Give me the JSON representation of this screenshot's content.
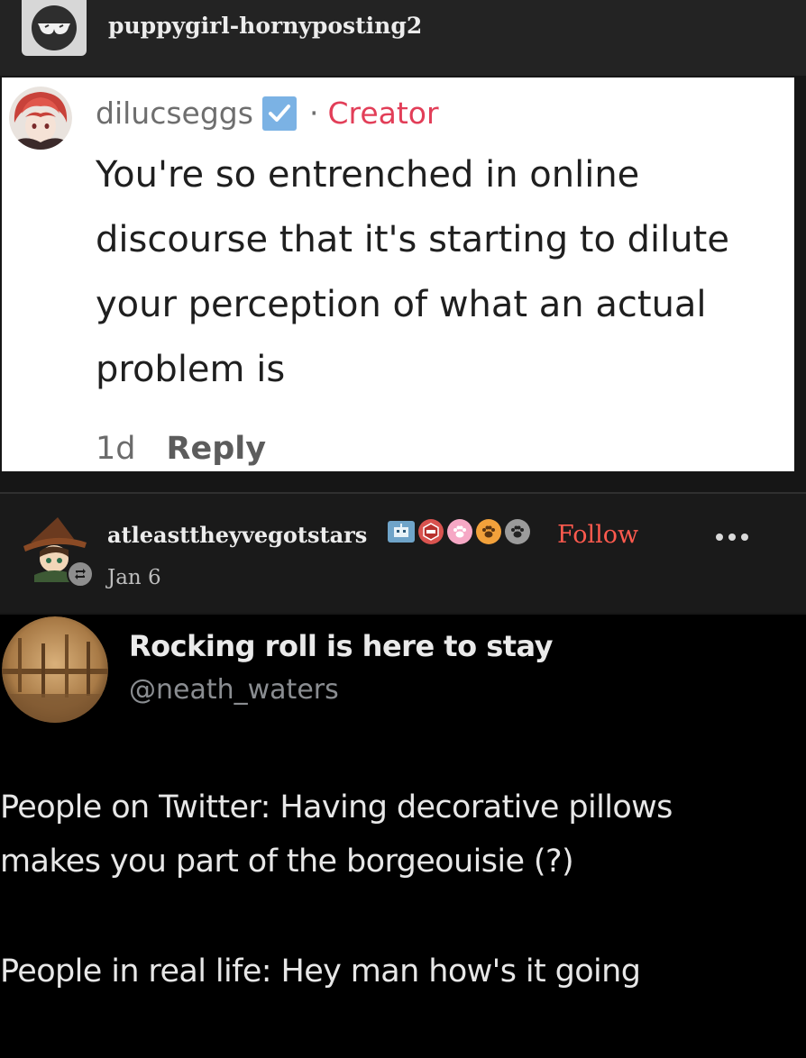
{
  "header": {
    "blog_name": "puppygirl-hornyposting2",
    "avatar_icon": "sunglasses-face-icon"
  },
  "comment": {
    "username": "dilucseggs",
    "verified_icon": "verified-check-icon",
    "separator": "·",
    "role": "Creator",
    "text": "You're so entrenched in online discourse that it's starting to dilute your perception of what an actual problem is",
    "age": "1d",
    "reply_label": "Reply",
    "colors": {
      "creator": "#e23e58",
      "verified": "#7bb2e4"
    }
  },
  "reblog": {
    "username": "atleasttheyvegotstars",
    "date": "Jan 6",
    "follow_label": "Follow",
    "badge_icons": [
      "robot-badge-icon",
      "red-hexagon-badge-icon",
      "pink-paw-badge-icon",
      "orange-paw-badge-icon",
      "gray-paw-badge-icon"
    ],
    "reblog_icon": "reblog-arrows-icon",
    "more_icon": "more-dots-icon",
    "colors": {
      "follow": "#ff5a4e"
    }
  },
  "tweet": {
    "display_name": "Rocking roll is here to stay",
    "handle": "@neath_waters",
    "paragraph_1": "People on Twitter: Having decorative pillows makes you part of the borgeouisie (?)",
    "paragraph_1_lines": [
      "People on Twitter: Having decorative pillows",
      "makes you part of the borgeouisie (?)"
    ],
    "paragraph_2": "People in real life: Hey man how's it going"
  }
}
